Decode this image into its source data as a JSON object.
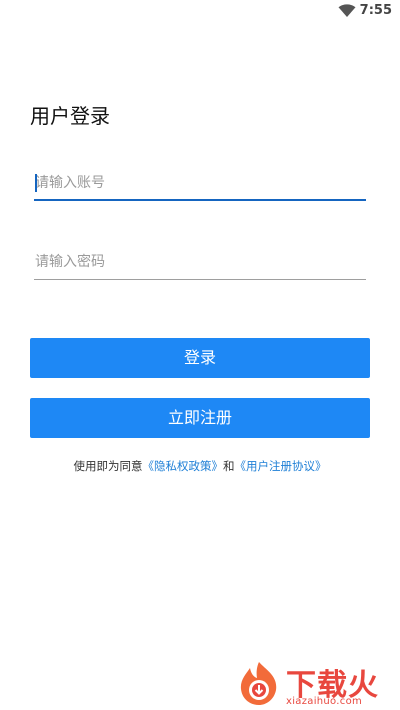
{
  "status_bar": {
    "time": "7:55",
    "wifi_icon": "wifi-icon"
  },
  "login": {
    "title": "用户登录",
    "account_placeholder": "请输入账号",
    "password_placeholder": "请输入密码",
    "login_button": "登录",
    "register_button": "立即注册"
  },
  "agreement": {
    "prefix": "使用即为同意",
    "privacy_link": "《隐私权政策》",
    "conjunction": "和",
    "terms_link": "《用户注册协议》"
  },
  "watermark": {
    "brand": "下载火",
    "url": "xiazaihuo.com",
    "icon": "flame-download-icon"
  },
  "colors": {
    "accent": "#1e88f5",
    "link": "#1e7fd6",
    "focus_underline": "#1565c0",
    "watermark": "#e8473e"
  }
}
